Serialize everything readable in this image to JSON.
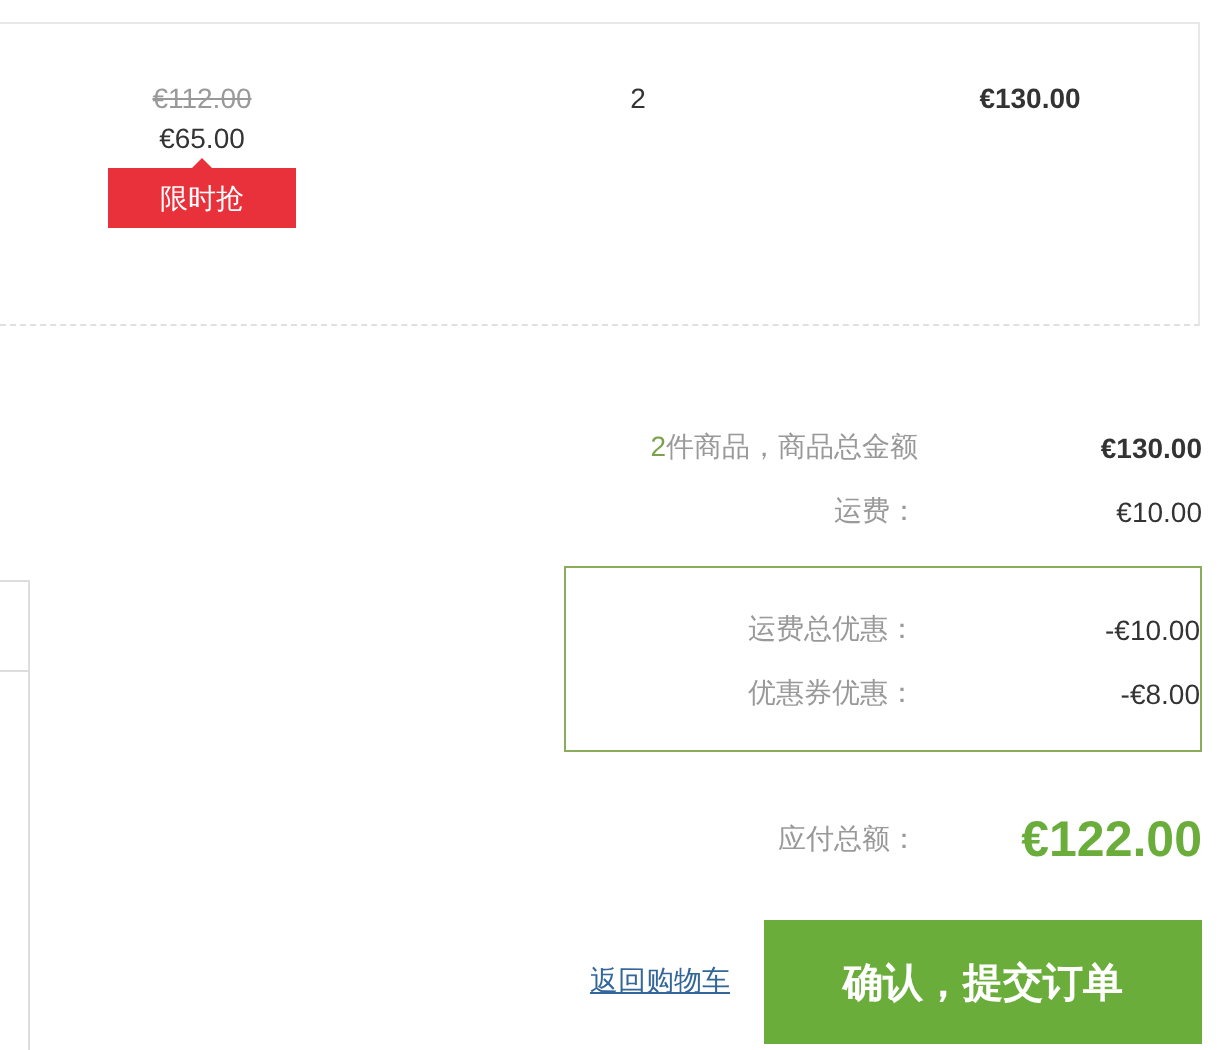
{
  "item": {
    "original_price": "€112.00",
    "price": "€65.00",
    "tag": "限时抢",
    "quantity": "2",
    "subtotal": "€130.00"
  },
  "summary": {
    "item_count": "2",
    "item_count_label": "件商品，商品总金额",
    "goods_total": "€130.00",
    "rows": [
      {
        "label": "运费：",
        "value": "€10.00"
      }
    ],
    "discounts": [
      {
        "label": "运费总优惠：",
        "value": "-€10.00"
      },
      {
        "label": "优惠券优惠：",
        "value": "-€8.00"
      }
    ],
    "payable_label": "应付总额：",
    "payable": "€122.00"
  },
  "actions": {
    "back_link": "返回购物车",
    "submit": "确认，提交订单"
  }
}
